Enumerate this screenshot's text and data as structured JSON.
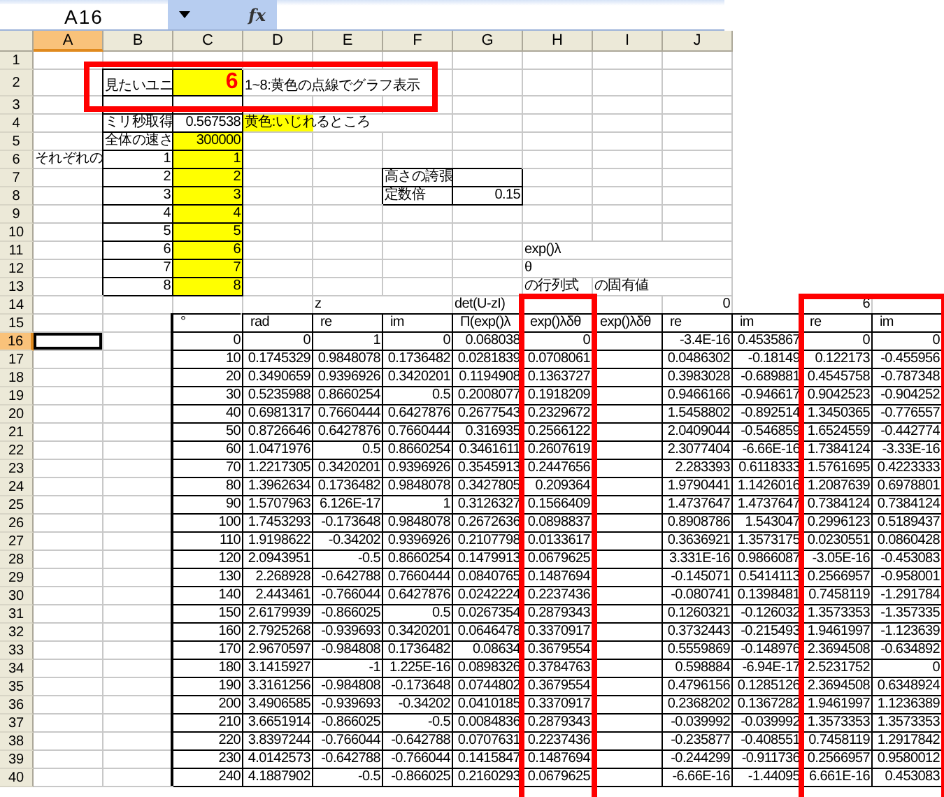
{
  "formula_bar": {
    "name_box": "A16",
    "function_label": "fx"
  },
  "columns": [
    {
      "label": "A",
      "selected": true
    },
    {
      "label": "B",
      "selected": false
    },
    {
      "label": "C",
      "selected": false
    },
    {
      "label": "D",
      "selected": false
    },
    {
      "label": "E",
      "selected": false
    },
    {
      "label": "F",
      "selected": false
    },
    {
      "label": "G",
      "selected": false
    },
    {
      "label": "H",
      "selected": false
    },
    {
      "label": "I",
      "selected": false
    },
    {
      "label": "J",
      "selected": false
    }
  ],
  "rows": [
    {
      "number": "1",
      "selected": false,
      "outlined": false
    },
    {
      "number": "2",
      "selected": false,
      "outlined": true,
      "cells": {
        "B": {
          "text": "見たいユニ",
          "kind": "boxed-text"
        },
        "C": {
          "text": "6",
          "kind": "unit-input"
        },
        "D": {
          "text": "1~8:黄色の点線でグラフ表示",
          "kind": "text"
        }
      }
    },
    {
      "number": "3",
      "selected": false,
      "outlined": false,
      "cells": {
        "B": {
          "kind": "boxed"
        },
        "C": {
          "kind": "boxed"
        }
      }
    },
    {
      "number": "4",
      "selected": false,
      "outlined": false,
      "cells": {
        "B": {
          "text": "ミリ秒取得",
          "kind": "boxed-text"
        },
        "C": {
          "text": "0.567538",
          "kind": "boxed-number"
        },
        "D": {
          "text": "黄色:いじれるところ",
          "kind": "legend"
        }
      }
    },
    {
      "number": "5",
      "selected": false,
      "outlined": false,
      "cells": {
        "B": {
          "text": "全体の速さ",
          "kind": "boxed-text"
        },
        "C": {
          "text": "300000",
          "kind": "input"
        }
      }
    },
    {
      "number": "6",
      "selected": false,
      "outlined": false,
      "cells": {
        "A": {
          "text": "それぞれの",
          "kind": "text"
        },
        "B": {
          "text": "1",
          "kind": "boxed-number"
        },
        "C": {
          "text": "1",
          "kind": "input"
        }
      }
    },
    {
      "number": "7",
      "selected": false,
      "outlined": false,
      "cells": {
        "B": {
          "text": "2",
          "kind": "boxed-number"
        },
        "C": {
          "text": "2",
          "kind": "input"
        },
        "F": {
          "text": "高さの誇張",
          "kind": "boxed-text"
        },
        "G": {
          "kind": "boxed"
        }
      }
    },
    {
      "number": "8",
      "selected": false,
      "outlined": false,
      "cells": {
        "B": {
          "text": "3",
          "kind": "boxed-number"
        },
        "C": {
          "text": "3",
          "kind": "input"
        },
        "F": {
          "text": "定数倍",
          "kind": "boxed-text"
        },
        "G": {
          "text": "0.15",
          "kind": "boxed-number"
        }
      }
    },
    {
      "number": "9",
      "selected": false,
      "outlined": false,
      "cells": {
        "B": {
          "text": "4",
          "kind": "boxed-number"
        },
        "C": {
          "text": "4",
          "kind": "input"
        }
      }
    },
    {
      "number": "10",
      "selected": false,
      "outlined": false,
      "cells": {
        "B": {
          "text": "5",
          "kind": "boxed-number"
        },
        "C": {
          "text": "5",
          "kind": "input"
        }
      }
    },
    {
      "number": "11",
      "selected": false,
      "outlined": false,
      "cells": {
        "B": {
          "text": "6",
          "kind": "boxed-number"
        },
        "C": {
          "text": "6",
          "kind": "input"
        },
        "H": {
          "text": "exp()λ",
          "kind": "text"
        }
      }
    },
    {
      "number": "12",
      "selected": false,
      "outlined": false,
      "cells": {
        "B": {
          "text": "7",
          "kind": "boxed-number"
        },
        "C": {
          "text": "7",
          "kind": "input"
        },
        "H": {
          "text": "θ",
          "kind": "text"
        }
      }
    },
    {
      "number": "13",
      "selected": false,
      "outlined": false,
      "cells": {
        "B": {
          "text": "8",
          "kind": "boxed-number"
        },
        "C": {
          "text": "8",
          "kind": "input"
        },
        "H": {
          "text": "の行列式",
          "kind": "text"
        },
        "I": {
          "text": "の固有値",
          "kind": "text"
        }
      }
    },
    {
      "number": "14",
      "selected": false,
      "outlined": false,
      "cells": {
        "E": {
          "text": "z",
          "kind": "text",
          "outlined": false
        },
        "G": {
          "text": "det(U-zI)",
          "kind": "text",
          "outlined": false
        },
        "H": {
          "outlined": true
        },
        "J": {
          "text": "0",
          "kind": "number",
          "outlined": false
        },
        "L": {
          "text": "6",
          "kind": "number",
          "outlined": true
        },
        "M": {
          "outlined": true
        }
      }
    },
    {
      "number": "15",
      "selected": false,
      "outlined": false,
      "cells": {
        "C": {
          "text": "°",
          "kind": "header"
        },
        "D": {
          "text": "rad",
          "kind": "header"
        },
        "E": {
          "text": "re",
          "kind": "header"
        },
        "F": {
          "text": "im",
          "kind": "header"
        },
        "G": {
          "text": "Π(exp()λ",
          "kind": "header"
        },
        "H": {
          "text": "exp()λδθ",
          "kind": "header"
        },
        "I": {
          "text": "exp()λδθ",
          "kind": "header"
        },
        "J": {
          "text": "re",
          "kind": "header"
        },
        "K": {
          "text": "im",
          "kind": "header"
        },
        "L": {
          "text": "re",
          "kind": "header"
        },
        "M": {
          "text": "im",
          "kind": "header"
        }
      }
    },
    {
      "number": "16",
      "selected": true,
      "outlined": false,
      "cells": {
        "C": {
          "text": "0",
          "kind": "number"
        },
        "D": {
          "text": "0",
          "kind": "number"
        },
        "E": {
          "text": "1",
          "kind": "number"
        },
        "F": {
          "text": "0",
          "kind": "number"
        },
        "G": {
          "text": "0.068038",
          "kind": "number"
        },
        "H": {
          "text": "0",
          "kind": "number"
        },
        "J": {
          "text": "-3.4E-16",
          "kind": "number"
        },
        "K": {
          "text": "0.4535867",
          "kind": "number"
        },
        "L": {
          "text": "0",
          "kind": "number"
        },
        "M": {
          "text": "0",
          "kind": "number"
        }
      }
    },
    {
      "number": "17",
      "selected": false,
      "outlined": false,
      "cells": {
        "C": {
          "text": "10",
          "kind": "number"
        },
        "D": {
          "text": "0.1745329",
          "kind": "number"
        },
        "E": {
          "text": "0.9848078",
          "kind": "number"
        },
        "F": {
          "text": "0.1736482",
          "kind": "number"
        },
        "G": {
          "text": "0.0281839",
          "kind": "number"
        },
        "H": {
          "text": "0.0708061",
          "kind": "number"
        },
        "J": {
          "text": "0.0486302",
          "kind": "number"
        },
        "K": {
          "text": "-0.18149",
          "kind": "number"
        },
        "L": {
          "text": "0.122173",
          "kind": "number"
        },
        "M": {
          "text": "-0.455956",
          "kind": "number"
        }
      }
    },
    {
      "number": "18",
      "selected": false,
      "outlined": false,
      "cells": {
        "C": {
          "text": "20",
          "kind": "number"
        },
        "D": {
          "text": "0.3490659",
          "kind": "number"
        },
        "E": {
          "text": "0.9396926",
          "kind": "number"
        },
        "F": {
          "text": "0.3420201",
          "kind": "number"
        },
        "G": {
          "text": "0.1194908",
          "kind": "number"
        },
        "H": {
          "text": "0.1363727",
          "kind": "number"
        },
        "J": {
          "text": "0.3983028",
          "kind": "number"
        },
        "K": {
          "text": "-0.689881",
          "kind": "number"
        },
        "L": {
          "text": "0.4545758",
          "kind": "number"
        },
        "M": {
          "text": "-0.787348",
          "kind": "number"
        }
      }
    },
    {
      "number": "19",
      "selected": false,
      "outlined": false,
      "cells": {
        "C": {
          "text": "30",
          "kind": "number"
        },
        "D": {
          "text": "0.5235988",
          "kind": "number"
        },
        "E": {
          "text": "0.8660254",
          "kind": "number"
        },
        "F": {
          "text": "0.5",
          "kind": "number"
        },
        "G": {
          "text": "0.2008077",
          "kind": "number"
        },
        "H": {
          "text": "0.1918209",
          "kind": "number"
        },
        "J": {
          "text": "0.9466166",
          "kind": "number"
        },
        "K": {
          "text": "-0.946617",
          "kind": "number"
        },
        "L": {
          "text": "0.9042523",
          "kind": "number"
        },
        "M": {
          "text": "-0.904252",
          "kind": "number"
        }
      }
    },
    {
      "number": "20",
      "selected": false,
      "outlined": false,
      "cells": {
        "C": {
          "text": "40",
          "kind": "number"
        },
        "D": {
          "text": "0.6981317",
          "kind": "number"
        },
        "E": {
          "text": "0.7660444",
          "kind": "number"
        },
        "F": {
          "text": "0.6427876",
          "kind": "number"
        },
        "G": {
          "text": "0.2677543",
          "kind": "number"
        },
        "H": {
          "text": "0.2329672",
          "kind": "number"
        },
        "J": {
          "text": "1.5458802",
          "kind": "number"
        },
        "K": {
          "text": "-0.892514",
          "kind": "number"
        },
        "L": {
          "text": "1.3450365",
          "kind": "number"
        },
        "M": {
          "text": "-0.776557",
          "kind": "number"
        }
      }
    },
    {
      "number": "21",
      "selected": false,
      "outlined": false,
      "cells": {
        "C": {
          "text": "50",
          "kind": "number"
        },
        "D": {
          "text": "0.8726646",
          "kind": "number"
        },
        "E": {
          "text": "0.6427876",
          "kind": "number"
        },
        "F": {
          "text": "0.7660444",
          "kind": "number"
        },
        "G": {
          "text": "0.316935",
          "kind": "number"
        },
        "H": {
          "text": "0.2566122",
          "kind": "number"
        },
        "J": {
          "text": "2.0409044",
          "kind": "number"
        },
        "K": {
          "text": "-0.546859",
          "kind": "number"
        },
        "L": {
          "text": "1.6524559",
          "kind": "number"
        },
        "M": {
          "text": "-0.442774",
          "kind": "number"
        }
      }
    },
    {
      "number": "22",
      "selected": false,
      "outlined": false,
      "cells": {
        "C": {
          "text": "60",
          "kind": "number"
        },
        "D": {
          "text": "1.0471976",
          "kind": "number"
        },
        "E": {
          "text": "0.5",
          "kind": "number"
        },
        "F": {
          "text": "0.8660254",
          "kind": "number"
        },
        "G": {
          "text": "0.3461611",
          "kind": "number"
        },
        "H": {
          "text": "0.2607619",
          "kind": "number"
        },
        "J": {
          "text": "2.3077404",
          "kind": "number"
        },
        "K": {
          "text": "-6.66E-16",
          "kind": "number"
        },
        "L": {
          "text": "1.7384124",
          "kind": "number"
        },
        "M": {
          "text": "-3.33E-16",
          "kind": "number"
        }
      }
    },
    {
      "number": "23",
      "selected": false,
      "outlined": false,
      "cells": {
        "C": {
          "text": "70",
          "kind": "number"
        },
        "D": {
          "text": "1.2217305",
          "kind": "number"
        },
        "E": {
          "text": "0.3420201",
          "kind": "number"
        },
        "F": {
          "text": "0.9396926",
          "kind": "number"
        },
        "G": {
          "text": "0.3545913",
          "kind": "number"
        },
        "H": {
          "text": "0.2447656",
          "kind": "number"
        },
        "J": {
          "text": "2.283393",
          "kind": "number"
        },
        "K": {
          "text": "0.6118333",
          "kind": "number"
        },
        "L": {
          "text": "1.5761695",
          "kind": "number"
        },
        "M": {
          "text": "0.4223333",
          "kind": "number"
        }
      }
    },
    {
      "number": "24",
      "selected": false,
      "outlined": false,
      "cells": {
        "C": {
          "text": "80",
          "kind": "number"
        },
        "D": {
          "text": "1.3962634",
          "kind": "number"
        },
        "E": {
          "text": "0.1736482",
          "kind": "number"
        },
        "F": {
          "text": "0.9848078",
          "kind": "number"
        },
        "G": {
          "text": "0.3427805",
          "kind": "number"
        },
        "H": {
          "text": "0.209364",
          "kind": "number"
        },
        "J": {
          "text": "1.9790441",
          "kind": "number"
        },
        "K": {
          "text": "1.1426016",
          "kind": "number"
        },
        "L": {
          "text": "1.2087639",
          "kind": "number"
        },
        "M": {
          "text": "0.6978801",
          "kind": "number"
        }
      }
    },
    {
      "number": "25",
      "selected": false,
      "outlined": false,
      "cells": {
        "C": {
          "text": "90",
          "kind": "number"
        },
        "D": {
          "text": "1.5707963",
          "kind": "number"
        },
        "E": {
          "text": "6.126E-17",
          "kind": "number"
        },
        "F": {
          "text": "1",
          "kind": "number"
        },
        "G": {
          "text": "0.3126327",
          "kind": "number"
        },
        "H": {
          "text": "0.1566409",
          "kind": "number"
        },
        "J": {
          "text": "1.4737647",
          "kind": "number"
        },
        "K": {
          "text": "1.4737647",
          "kind": "number"
        },
        "L": {
          "text": "0.7384124",
          "kind": "number"
        },
        "M": {
          "text": "0.7384124",
          "kind": "number"
        }
      }
    },
    {
      "number": "26",
      "selected": false,
      "outlined": false,
      "cells": {
        "C": {
          "text": "100",
          "kind": "number"
        },
        "D": {
          "text": "1.7453293",
          "kind": "number"
        },
        "E": {
          "text": "-0.173648",
          "kind": "number"
        },
        "F": {
          "text": "0.9848078",
          "kind": "number"
        },
        "G": {
          "text": "0.2672636",
          "kind": "number"
        },
        "H": {
          "text": "0.0898837",
          "kind": "number"
        },
        "J": {
          "text": "0.8908786",
          "kind": "number"
        },
        "K": {
          "text": "1.543047",
          "kind": "number"
        },
        "L": {
          "text": "0.2996123",
          "kind": "number"
        },
        "M": {
          "text": "0.5189437",
          "kind": "number"
        }
      }
    },
    {
      "number": "27",
      "selected": false,
      "outlined": false,
      "cells": {
        "C": {
          "text": "110",
          "kind": "number"
        },
        "D": {
          "text": "1.9198622",
          "kind": "number"
        },
        "E": {
          "text": "-0.34202",
          "kind": "number"
        },
        "F": {
          "text": "0.9396926",
          "kind": "number"
        },
        "G": {
          "text": "0.2107798",
          "kind": "number"
        },
        "H": {
          "text": "0.0133617",
          "kind": "number"
        },
        "J": {
          "text": "0.3636921",
          "kind": "number"
        },
        "K": {
          "text": "1.3573175",
          "kind": "number"
        },
        "L": {
          "text": "0.0230551",
          "kind": "number"
        },
        "M": {
          "text": "0.0860428",
          "kind": "number"
        }
      }
    },
    {
      "number": "28",
      "selected": false,
      "outlined": false,
      "cells": {
        "C": {
          "text": "120",
          "kind": "number"
        },
        "D": {
          "text": "2.0943951",
          "kind": "number"
        },
        "E": {
          "text": "-0.5",
          "kind": "number"
        },
        "F": {
          "text": "0.8660254",
          "kind": "number"
        },
        "G": {
          "text": "0.1479913",
          "kind": "number"
        },
        "H": {
          "text": "0.0679625",
          "kind": "number"
        },
        "J": {
          "text": "3.331E-16",
          "kind": "number"
        },
        "K": {
          "text": "0.9866087",
          "kind": "number"
        },
        "L": {
          "text": "-3.05E-16",
          "kind": "number"
        },
        "M": {
          "text": "-0.453083",
          "kind": "number"
        }
      }
    },
    {
      "number": "29",
      "selected": false,
      "outlined": false,
      "cells": {
        "C": {
          "text": "130",
          "kind": "number"
        },
        "D": {
          "text": "2.268928",
          "kind": "number"
        },
        "E": {
          "text": "-0.642788",
          "kind": "number"
        },
        "F": {
          "text": "0.7660444",
          "kind": "number"
        },
        "G": {
          "text": "0.0840765",
          "kind": "number"
        },
        "H": {
          "text": "0.1487694",
          "kind": "number"
        },
        "J": {
          "text": "-0.145071",
          "kind": "number"
        },
        "K": {
          "text": "0.5414113",
          "kind": "number"
        },
        "L": {
          "text": "0.2566957",
          "kind": "number"
        },
        "M": {
          "text": "-0.958001",
          "kind": "number"
        }
      }
    },
    {
      "number": "30",
      "selected": false,
      "outlined": false,
      "cells": {
        "C": {
          "text": "140",
          "kind": "number"
        },
        "D": {
          "text": "2.443461",
          "kind": "number"
        },
        "E": {
          "text": "-0.766044",
          "kind": "number"
        },
        "F": {
          "text": "0.6427876",
          "kind": "number"
        },
        "G": {
          "text": "0.0242224",
          "kind": "number"
        },
        "H": {
          "text": "0.2237436",
          "kind": "number"
        },
        "J": {
          "text": "-0.080741",
          "kind": "number"
        },
        "K": {
          "text": "0.1398481",
          "kind": "number"
        },
        "L": {
          "text": "0.7458119",
          "kind": "number"
        },
        "M": {
          "text": "-1.291784",
          "kind": "number"
        }
      }
    },
    {
      "number": "31",
      "selected": false,
      "outlined": false,
      "cells": {
        "C": {
          "text": "150",
          "kind": "number"
        },
        "D": {
          "text": "2.6179939",
          "kind": "number"
        },
        "E": {
          "text": "-0.866025",
          "kind": "number"
        },
        "F": {
          "text": "0.5",
          "kind": "number"
        },
        "G": {
          "text": "0.0267354",
          "kind": "number"
        },
        "H": {
          "text": "0.2879343",
          "kind": "number"
        },
        "J": {
          "text": "0.1260321",
          "kind": "number"
        },
        "K": {
          "text": "-0.126032",
          "kind": "number"
        },
        "L": {
          "text": "1.3573353",
          "kind": "number"
        },
        "M": {
          "text": "-1.357335",
          "kind": "number"
        }
      }
    },
    {
      "number": "32",
      "selected": false,
      "outlined": false,
      "cells": {
        "C": {
          "text": "160",
          "kind": "number"
        },
        "D": {
          "text": "2.7925268",
          "kind": "number"
        },
        "E": {
          "text": "-0.939693",
          "kind": "number"
        },
        "F": {
          "text": "0.3420201",
          "kind": "number"
        },
        "G": {
          "text": "0.0646478",
          "kind": "number"
        },
        "H": {
          "text": "0.3370917",
          "kind": "number"
        },
        "J": {
          "text": "0.3732443",
          "kind": "number"
        },
        "K": {
          "text": "-0.215493",
          "kind": "number"
        },
        "L": {
          "text": "1.9461997",
          "kind": "number"
        },
        "M": {
          "text": "-1.123639",
          "kind": "number"
        }
      }
    },
    {
      "number": "33",
      "selected": false,
      "outlined": false,
      "cells": {
        "C": {
          "text": "170",
          "kind": "number"
        },
        "D": {
          "text": "2.9670597",
          "kind": "number"
        },
        "E": {
          "text": "-0.984808",
          "kind": "number"
        },
        "F": {
          "text": "0.1736482",
          "kind": "number"
        },
        "G": {
          "text": "0.08634",
          "kind": "number"
        },
        "H": {
          "text": "0.3679554",
          "kind": "number"
        },
        "J": {
          "text": "0.5559869",
          "kind": "number"
        },
        "K": {
          "text": "-0.148976",
          "kind": "number"
        },
        "L": {
          "text": "2.3694508",
          "kind": "number"
        },
        "M": {
          "text": "-0.634892",
          "kind": "number"
        }
      }
    },
    {
      "number": "34",
      "selected": false,
      "outlined": false,
      "cells": {
        "C": {
          "text": "180",
          "kind": "number"
        },
        "D": {
          "text": "3.1415927",
          "kind": "number"
        },
        "E": {
          "text": "-1",
          "kind": "number"
        },
        "F": {
          "text": "1.225E-16",
          "kind": "number"
        },
        "G": {
          "text": "0.0898326",
          "kind": "number"
        },
        "H": {
          "text": "0.3784763",
          "kind": "number"
        },
        "J": {
          "text": "0.598884",
          "kind": "number"
        },
        "K": {
          "text": "-6.94E-17",
          "kind": "number"
        },
        "L": {
          "text": "2.5231752",
          "kind": "number"
        },
        "M": {
          "text": "0",
          "kind": "number"
        }
      }
    },
    {
      "number": "35",
      "selected": false,
      "outlined": false,
      "cells": {
        "C": {
          "text": "190",
          "kind": "number"
        },
        "D": {
          "text": "3.3161256",
          "kind": "number"
        },
        "E": {
          "text": "-0.984808",
          "kind": "number"
        },
        "F": {
          "text": "-0.173648",
          "kind": "number"
        },
        "G": {
          "text": "0.0744802",
          "kind": "number"
        },
        "H": {
          "text": "0.3679554",
          "kind": "number"
        },
        "J": {
          "text": "0.4796156",
          "kind": "number"
        },
        "K": {
          "text": "0.1285126",
          "kind": "number"
        },
        "L": {
          "text": "2.3694508",
          "kind": "number"
        },
        "M": {
          "text": "0.6348924",
          "kind": "number"
        }
      }
    },
    {
      "number": "36",
      "selected": false,
      "outlined": false,
      "cells": {
        "C": {
          "text": "200",
          "kind": "number"
        },
        "D": {
          "text": "3.4906585",
          "kind": "number"
        },
        "E": {
          "text": "-0.939693",
          "kind": "number"
        },
        "F": {
          "text": "-0.34202",
          "kind": "number"
        },
        "G": {
          "text": "0.0410185",
          "kind": "number"
        },
        "H": {
          "text": "0.3370917",
          "kind": "number"
        },
        "J": {
          "text": "0.2368202",
          "kind": "number"
        },
        "K": {
          "text": "0.1367282",
          "kind": "number"
        },
        "L": {
          "text": "1.9461997",
          "kind": "number"
        },
        "M": {
          "text": "1.1236389",
          "kind": "number"
        }
      }
    },
    {
      "number": "37",
      "selected": false,
      "outlined": false,
      "cells": {
        "C": {
          "text": "210",
          "kind": "number"
        },
        "D": {
          "text": "3.6651914",
          "kind": "number"
        },
        "E": {
          "text": "-0.866025",
          "kind": "number"
        },
        "F": {
          "text": "-0.5",
          "kind": "number"
        },
        "G": {
          "text": "0.0084836",
          "kind": "number"
        },
        "H": {
          "text": "0.2879343",
          "kind": "number"
        },
        "J": {
          "text": "-0.039992",
          "kind": "number"
        },
        "K": {
          "text": "-0.039992",
          "kind": "number"
        },
        "L": {
          "text": "1.3573353",
          "kind": "number"
        },
        "M": {
          "text": "1.3573353",
          "kind": "number"
        }
      }
    },
    {
      "number": "38",
      "selected": false,
      "outlined": false,
      "cells": {
        "C": {
          "text": "220",
          "kind": "number"
        },
        "D": {
          "text": "3.8397244",
          "kind": "number"
        },
        "E": {
          "text": "-0.766044",
          "kind": "number"
        },
        "F": {
          "text": "-0.642788",
          "kind": "number"
        },
        "G": {
          "text": "0.0707631",
          "kind": "number"
        },
        "H": {
          "text": "0.2237436",
          "kind": "number"
        },
        "J": {
          "text": "-0.235877",
          "kind": "number"
        },
        "K": {
          "text": "-0.408551",
          "kind": "number"
        },
        "L": {
          "text": "0.7458119",
          "kind": "number"
        },
        "M": {
          "text": "1.2917842",
          "kind": "number"
        }
      }
    },
    {
      "number": "39",
      "selected": false,
      "outlined": false,
      "cells": {
        "C": {
          "text": "230",
          "kind": "number"
        },
        "D": {
          "text": "4.0142573",
          "kind": "number"
        },
        "E": {
          "text": "-0.642788",
          "kind": "number"
        },
        "F": {
          "text": "-0.766044",
          "kind": "number"
        },
        "G": {
          "text": "0.1415847",
          "kind": "number"
        },
        "H": {
          "text": "0.1487694",
          "kind": "number"
        },
        "J": {
          "text": "-0.244299",
          "kind": "number"
        },
        "K": {
          "text": "-0.911736",
          "kind": "number"
        },
        "L": {
          "text": "0.2566957",
          "kind": "number"
        },
        "M": {
          "text": "0.9580012",
          "kind": "number"
        }
      }
    },
    {
      "number": "40",
      "selected": false,
      "outlined": false,
      "cells": {
        "C": {
          "text": "240",
          "kind": "number"
        },
        "D": {
          "text": "4.1887902",
          "kind": "number"
        },
        "E": {
          "text": "-0.5",
          "kind": "number"
        },
        "F": {
          "text": "-0.866025",
          "kind": "number"
        },
        "G": {
          "text": "0.2160293",
          "kind": "number"
        },
        "H": {
          "text": "0.0679625",
          "kind": "number"
        },
        "J": {
          "text": "-6.66E-16",
          "kind": "number"
        },
        "K": {
          "text": "-1.44095",
          "kind": "number"
        },
        "L": {
          "text": "6.661E-16",
          "kind": "number"
        },
        "M": {
          "text": "0.453083",
          "kind": "number"
        }
      }
    }
  ]
}
